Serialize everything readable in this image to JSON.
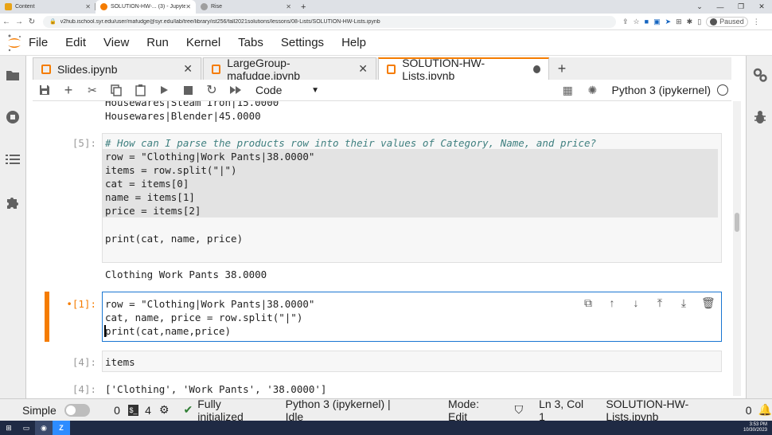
{
  "browser": {
    "tabs": [
      {
        "title": "Content",
        "color": "#e8a317"
      },
      {
        "title": "SOLUTION-HW-... (3) - Jupyterl...",
        "color": "#f57c00"
      },
      {
        "title": "Rise",
        "color": "#9e9e9e"
      }
    ],
    "url": "v2hub.ischool.syr.edu/user/mafudge@syr.edu/lab/tree/library/ist256/fall2021solutions/lessons/08-Lists/SOLUTION-HW-Lists.ipynb",
    "profile_status": "Paused"
  },
  "menu": [
    "File",
    "Edit",
    "View",
    "Run",
    "Kernel",
    "Tabs",
    "Settings",
    "Help"
  ],
  "notebook_tabs": [
    {
      "title": "Slides.ipynb",
      "active": false
    },
    {
      "title": "LargeGroup-mafudge.ipynb",
      "active": false
    },
    {
      "title": "SOLUTION-HW-Lists.ipynb",
      "active": true
    }
  ],
  "toolbar": {
    "cell_type": "Code",
    "kernel": "Python 3 (ipykernel)"
  },
  "cells": {
    "top_output": [
      "Housewares|Steam Iron|15.0000",
      "Housewares|Blender|45.0000"
    ],
    "cell5": {
      "prompt": "[5]:",
      "lines": [
        "# How can I parse the products row into their values of Category, Name, and price?",
        "row = \"Clothing|Work Pants|38.0000\"",
        "items = row.split(\"|\")",
        "cat = items[0]",
        "name = items[1]",
        "price = items[2]",
        "",
        "print(cat, name, price)"
      ],
      "output": "Clothing Work Pants 38.0000"
    },
    "cell1": {
      "prompt": "•[1]:",
      "lines": [
        "row = \"Clothing|Work Pants|38.0000\"",
        "cat, name, price = row.split(\"|\")",
        "print(cat,name,price)"
      ]
    },
    "cell4": {
      "prompt": "[4]:",
      "code": "items",
      "out_prompt": "[4]:",
      "output": "['Clothing', 'Work Pants', '38.0000']"
    }
  },
  "status": {
    "mode_label": "Simple",
    "count_a": "0",
    "count_b": "4",
    "init": "Fully initialized",
    "kernel": "Python 3 (ipykernel) | Idle",
    "mode": "Mode: Edit",
    "position": "Ln 3, Col 1",
    "file": "SOLUTION-HW-Lists.ipynb",
    "notifications": "0"
  },
  "taskbar": {
    "time": "3:53 PM",
    "date": "10/30/2023"
  }
}
